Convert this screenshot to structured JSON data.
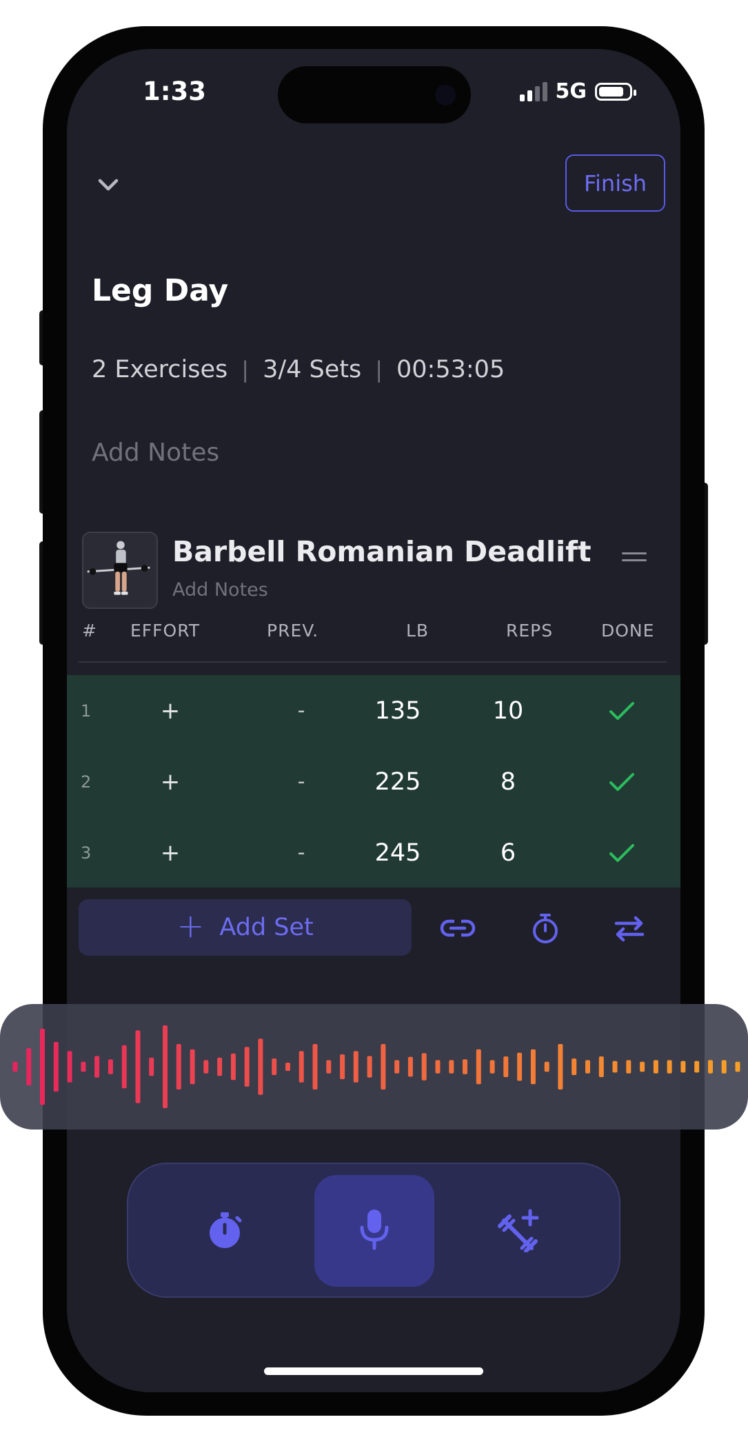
{
  "status_bar": {
    "time": "1:33",
    "network": "5G"
  },
  "header": {
    "finish_label": "Finish"
  },
  "workout": {
    "title": "Leg Day",
    "exercises": "2 Exercises",
    "sets": "3/4 Sets",
    "timer": "00:53:05",
    "separator": "|",
    "notes_placeholder": "Add Notes"
  },
  "exercise": {
    "name": "Barbell Romanian Deadlift",
    "notes_placeholder": "Add Notes",
    "columns": [
      "#",
      "EFFORT",
      "PREV.",
      "LB",
      "REPS",
      "DONE"
    ],
    "sets": [
      {
        "num": "1",
        "effort": "+",
        "prev": "-",
        "lb": "135",
        "reps": "10",
        "done": true
      },
      {
        "num": "2",
        "effort": "+",
        "prev": "-",
        "lb": "225",
        "reps": "8",
        "done": true
      },
      {
        "num": "3",
        "effort": "+",
        "prev": "-",
        "lb": "245",
        "reps": "6",
        "done": true
      }
    ],
    "add_set_label": "Add Set",
    "tools": [
      "link-icon",
      "stopwatch-icon",
      "swap-icon"
    ]
  },
  "voice_overlay": {
    "amplitudes": [
      0.12,
      0.45,
      0.92,
      0.6,
      0.38,
      0.12,
      0.26,
      0.18,
      0.52,
      0.88,
      0.22,
      1.0,
      0.55,
      0.42,
      0.16,
      0.22,
      0.32,
      0.48,
      0.68,
      0.2,
      0.1,
      0.38,
      0.55,
      0.16,
      0.3,
      0.38,
      0.26,
      0.55,
      0.16,
      0.24,
      0.33,
      0.16,
      0.16,
      0.18,
      0.42,
      0.16,
      0.25,
      0.34,
      0.42,
      0.12,
      0.55,
      0.2,
      0.16,
      0.25,
      0.14,
      0.16,
      0.12,
      0.16,
      0.16,
      0.14,
      0.14,
      0.16,
      0.16,
      0.12
    ],
    "color_start": "#e8245e",
    "color_end": "#f7a028"
  },
  "dock": {
    "items": [
      "stopwatch-icon",
      "microphone-icon",
      "add-exercise-icon"
    ],
    "active": "microphone-icon"
  },
  "colors": {
    "accent": "#6262ef",
    "done_green": "#2bbd5d",
    "completed_row": "#213a33",
    "background": "#1f1f29"
  }
}
